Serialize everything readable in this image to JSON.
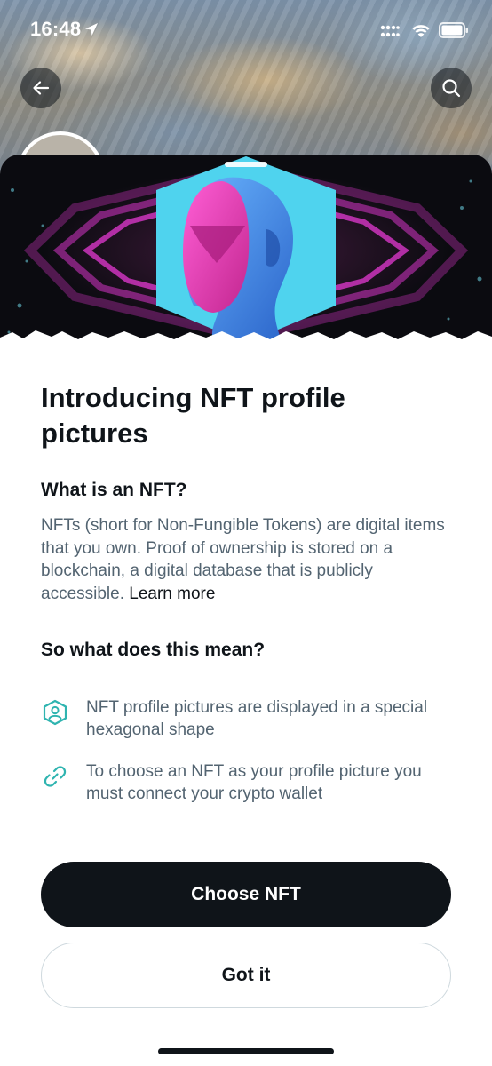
{
  "status_bar": {
    "time": "16:48"
  },
  "header": {
    "back_icon": "arrow-left-icon",
    "search_icon": "search-icon"
  },
  "sheet": {
    "title": "Introducing NFT profile pictures",
    "what_heading": "What is an NFT?",
    "what_body": "NFTs (short for Non-Fungible Tokens) are digital items that you own. Proof of ownership is stored on a blockchain, a digital database that is publicly accessible.",
    "learn_more": "Learn more",
    "mean_heading": "So what does this mean?",
    "features": [
      {
        "icon": "hexagon-profile-icon",
        "text": "NFT profile pictures are displayed in a special hexagonal shape"
      },
      {
        "icon": "link-icon",
        "text": "To choose an NFT as your profile picture you must connect your crypto wallet"
      }
    ],
    "primary_button": "Choose NFT",
    "secondary_button": "Got it"
  },
  "colors": {
    "text_primary": "#0f1419",
    "text_secondary": "#536471",
    "accent_teal": "#2fb4b0",
    "button_dark": "#0f1419",
    "button_border": "#cfd9de"
  }
}
